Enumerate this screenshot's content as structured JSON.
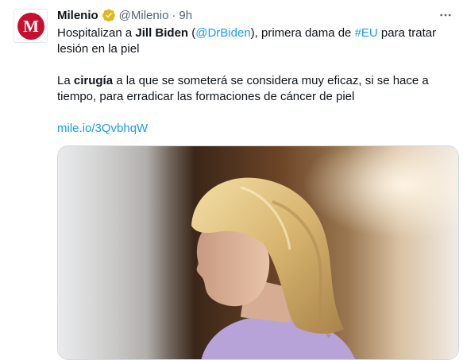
{
  "author": {
    "name": "Milenio",
    "handle": "@Milenio",
    "separator": "·",
    "time": "9h",
    "avatar_letter": "M",
    "brand_color": "#c8102e",
    "verified_color": "#e2b719"
  },
  "tweet": {
    "line1_a": "Hospitalizan a ",
    "line1_b": "Jill Biden",
    "line1_c": " (",
    "line1_mention": "@DrBiden",
    "line1_d": "), primera dama de ",
    "line1_hashtag": "#EU",
    "line1_e": " para tratar lesión en la piel",
    "line2_a": "La ",
    "line2_b": "cirugía",
    "line2_c": " a la que se someterá se considera muy eficaz, si se hace a tiempo, para erradicar las formaciones de cáncer de piel",
    "url": "mile.io/3QvbhqW"
  },
  "media": {
    "description_icon": "photo-image",
    "accent_color": "#1d9bf0"
  }
}
